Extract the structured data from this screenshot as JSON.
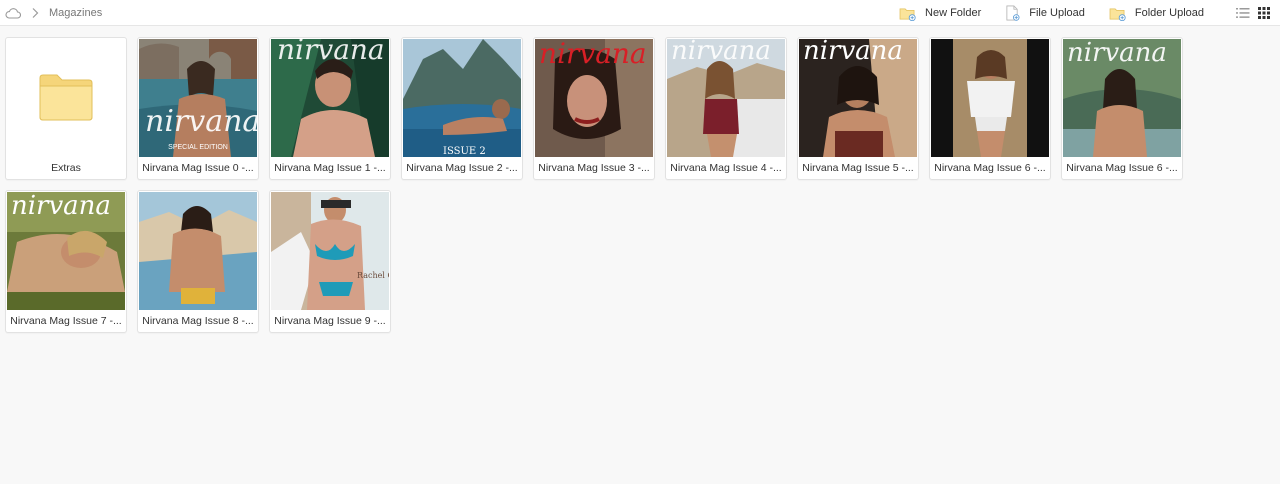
{
  "breadcrumb": {
    "home_icon": "cloud-icon",
    "separator_icon": "chevron-right-icon",
    "current": "Magazines"
  },
  "toolbar": {
    "new_folder": "New Folder",
    "file_upload": "File Upload",
    "folder_upload": "Folder Upload",
    "list_view_icon": "list-view-icon",
    "grid_view_icon": "grid-view-icon"
  },
  "colors": {
    "folder": "#fbe49a",
    "folder_stroke": "#e8c96a",
    "accent": "#3b7ec9"
  },
  "items": [
    {
      "type": "folder",
      "name": "Extras"
    },
    {
      "type": "image",
      "name": "Nirvana Mag Issue 0 -...",
      "cover_text": "SPECIAL EDITION"
    },
    {
      "type": "image",
      "name": "Nirvana Mag Issue 1 -..."
    },
    {
      "type": "image",
      "name": "Nirvana Mag Issue 2 -...",
      "cover_text": "ISSUE 2"
    },
    {
      "type": "image",
      "name": "Nirvana Mag Issue 3 -..."
    },
    {
      "type": "image",
      "name": "Nirvana Mag Issue 4 -..."
    },
    {
      "type": "image",
      "name": "Nirvana Mag Issue 5 -..."
    },
    {
      "type": "image",
      "name": "Nirvana Mag Issue 6 -..."
    },
    {
      "type": "image",
      "name": "Nirvana Mag Issue 6 -..."
    },
    {
      "type": "image",
      "name": "Nirvana Mag Issue 7 -..."
    },
    {
      "type": "image",
      "name": "Nirvana Mag Issue 8 -..."
    },
    {
      "type": "image",
      "name": "Nirvana Mag Issue 9 -...",
      "cover_text": "Rachel COOK"
    }
  ]
}
